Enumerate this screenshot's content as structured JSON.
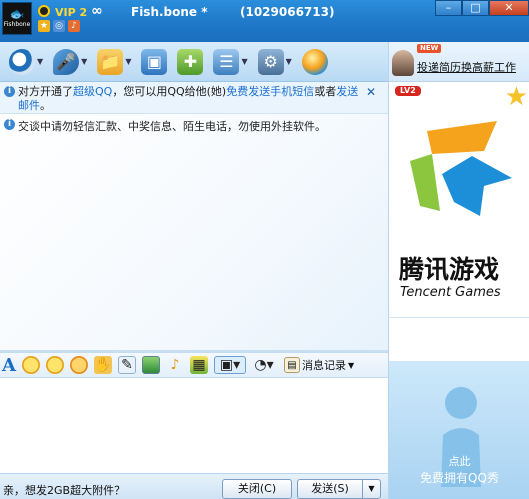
{
  "window": {
    "avatar_label": "Fishbone",
    "vip_label": "VIP 2",
    "infinity": "∞",
    "contact_name": "Fish.bone",
    "contact_name_suffix": "*",
    "qq_number": "(1029066713)",
    "controls": {
      "minimize": "–",
      "maximize": "□",
      "close": "✕"
    }
  },
  "toolbar": {
    "items": [
      {
        "icon": "video-icon"
      },
      {
        "icon": "voice-icon"
      },
      {
        "icon": "send-file-icon"
      },
      {
        "icon": "remote-assist-icon"
      },
      {
        "icon": "create-discussion-icon"
      },
      {
        "icon": "app-share-icon"
      },
      {
        "icon": "more-settings-icon"
      },
      {
        "icon": "qq-game-icon"
      }
    ]
  },
  "info_bar": {
    "text_a": "对方开通了",
    "link_super_qq": "超级QQ",
    "text_b": "，您可以用QQ给他(她)",
    "link_sms": "免费发送手机短信",
    "text_c": "或者",
    "link_mail": "发送邮件",
    "text_d": "。",
    "close": "✕"
  },
  "chat": {
    "notice": "交谈中请勿轻信汇款、中奖信息、陌生电话，勿使用外挂软件。"
  },
  "format_bar": {
    "font_label": "A",
    "history_label": "消息记录"
  },
  "bottom": {
    "prompt": "亲，想发2GB超大附件？",
    "close_button": "关闭(C)",
    "send_button": "发送(S)",
    "send_arrow": "▼"
  },
  "right_panel": {
    "ad_new_badge": "NEW",
    "ad_text": "投递简历换高薪工作",
    "level_badge": "LV2",
    "game_cn": "腾讯游戏",
    "game_en": "Tencent Games",
    "qqshow_line1": "点此",
    "qqshow_line2": "免费拥有QQ秀"
  },
  "colors": {
    "title_bar": "#1f78c8",
    "link": "#1b6fd0",
    "game_orange": "#f5a21c",
    "game_green": "#8cc63f",
    "game_blue": "#1d8fd8"
  }
}
